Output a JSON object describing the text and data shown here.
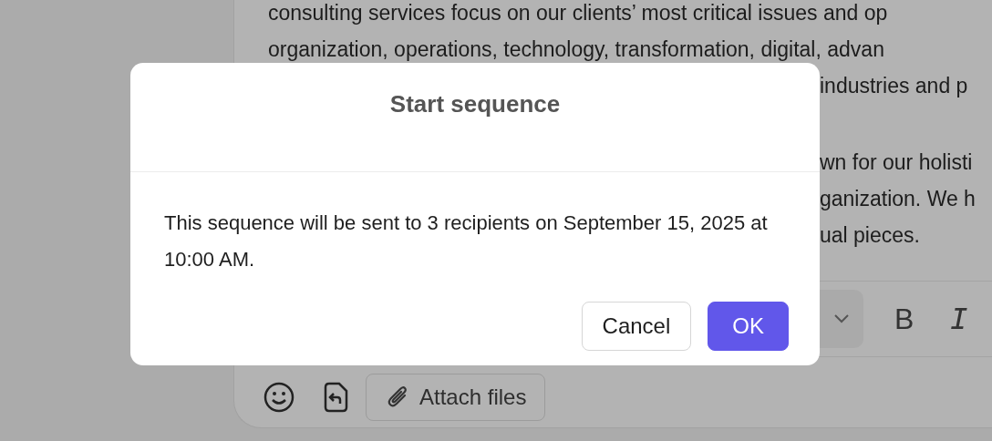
{
  "editor": {
    "lines": [
      "consulting services focus on our clients’ most critical issues and op",
      "organization, operations, technology, transformation, digital, advan"
    ],
    "fragments": [
      "industries and p",
      "wn for our holisti",
      "ganization. We h",
      "ual pieces."
    ],
    "format_buttons": [
      "B",
      "I"
    ],
    "attach_button": {
      "label": "Attach files"
    }
  },
  "dialog": {
    "title": "Start sequence",
    "message": "This sequence will be sent to 3 recipients on September 15, 2025 at 10:00 AM.",
    "buttons": [
      {
        "label": "Cancel",
        "kind": "secondary"
      },
      {
        "label": "OK",
        "kind": "primary"
      }
    ]
  }
}
